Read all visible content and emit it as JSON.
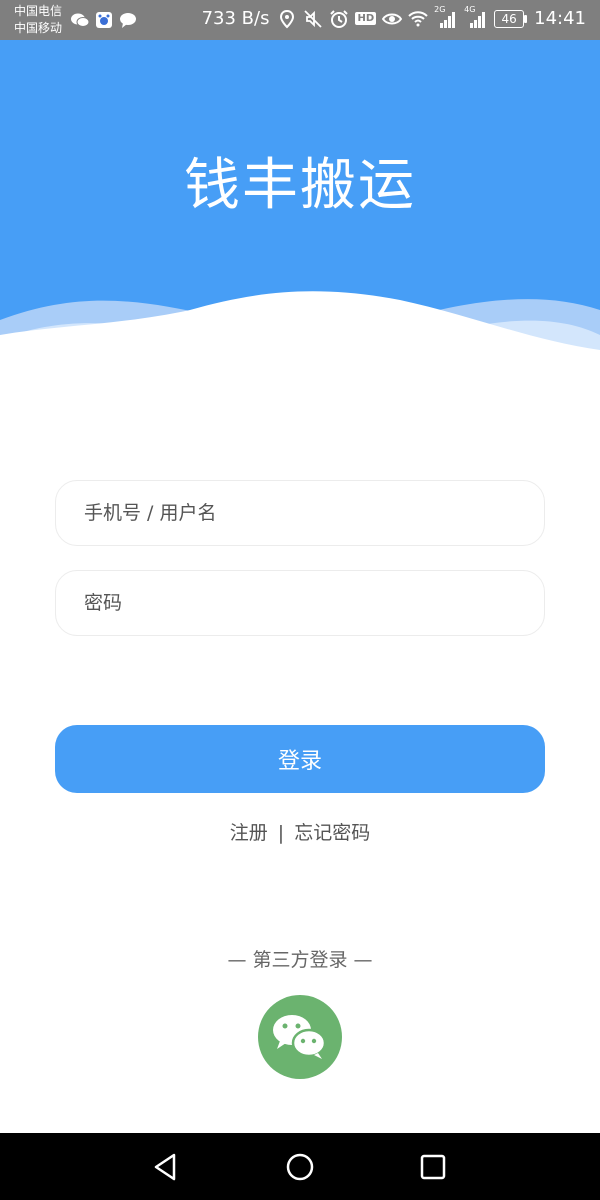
{
  "status_bar": {
    "carrier1": "中国电信",
    "carrier2": "中国移动",
    "speed": "733 B/s",
    "network1": "2G",
    "network2": "4G",
    "battery": "46",
    "time": "14:41",
    "hd": "HD"
  },
  "header": {
    "title": "钱丰搬运",
    "color": "#479ef6"
  },
  "form": {
    "username_placeholder": "手机号 / 用户名",
    "password_placeholder": "密码",
    "login_label": "登录"
  },
  "links": {
    "register": "注册",
    "separator": "|",
    "forgot": "忘记密码"
  },
  "third_party": {
    "label": "— 第三方登录 —",
    "wechat_icon": "wechat-icon",
    "wechat_color": "#6bb36f"
  },
  "nav": {
    "back_icon": "back-triangle-icon",
    "home_icon": "home-circle-icon",
    "recent_icon": "recent-square-icon"
  }
}
